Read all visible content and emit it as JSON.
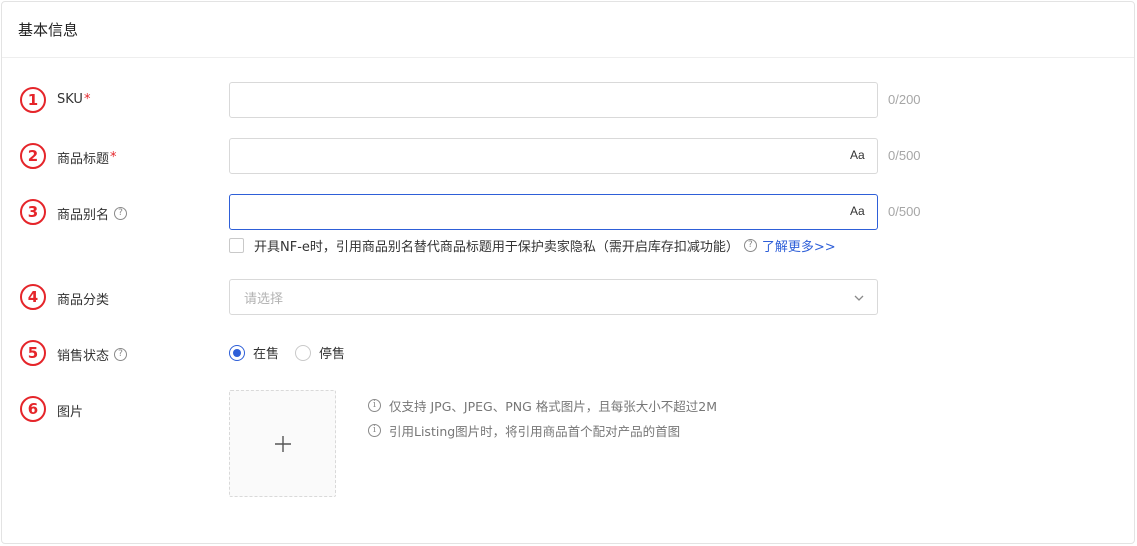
{
  "section": {
    "title": "基本信息"
  },
  "fields": {
    "sku": {
      "index": "1",
      "label": "SKU",
      "required": "*",
      "value": "",
      "counter": "0/200"
    },
    "title": {
      "index": "2",
      "label": "商品标题",
      "required": "*",
      "value": "",
      "case_toggle": "Aa",
      "counter": "0/500"
    },
    "alias": {
      "index": "3",
      "label": "商品别名",
      "help": "?",
      "value": "",
      "case_toggle": "Aa",
      "counter": "0/500",
      "checkbox_label": "开具NF-e时，引用商品别名替代商品标题用于保护卖家隐私（需开启库存扣减功能）",
      "link": "了解更多>>"
    },
    "category": {
      "index": "4",
      "label": "商品分类",
      "placeholder": "请选择"
    },
    "sale_status": {
      "index": "5",
      "label": "销售状态",
      "help": "?",
      "options": [
        "在售",
        "停售"
      ],
      "selected": "在售"
    },
    "images": {
      "index": "6",
      "label": "图片",
      "hints": [
        "仅支持 JPG、JPEG、PNG 格式图片，且每张大小不超过2M",
        "引用Listing图片时，将引用商品首个配对产品的首图"
      ]
    }
  },
  "colors": {
    "accent": "#2e5fd8",
    "badge": "#e5252a"
  }
}
